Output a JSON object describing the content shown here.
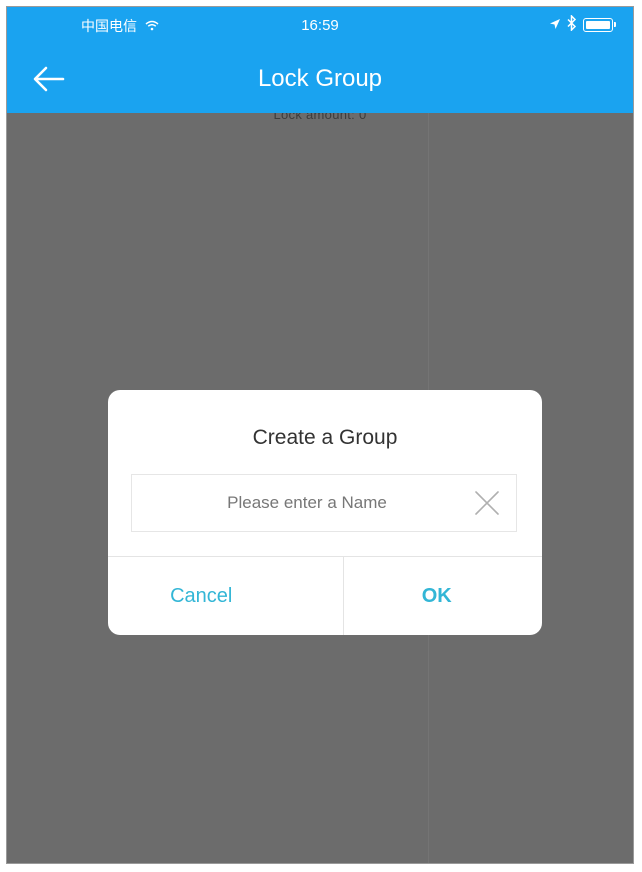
{
  "status_bar": {
    "carrier": "中国电信",
    "wifi_icon": "wifi-icon",
    "time": "16:59",
    "location_icon": "location-arrow-icon",
    "bluetooth_icon": "bluetooth-icon",
    "battery_icon": "battery-icon",
    "battery_level": 1.0
  },
  "nav": {
    "back_icon": "arrow-left-icon",
    "title": "Lock Group"
  },
  "background": {
    "lock_amount_text": "Lock amount: 0"
  },
  "dialog": {
    "title": "Create a Group",
    "name_input": {
      "value": "",
      "placeholder": "Please enter a Name"
    },
    "clear_icon": "close-icon",
    "cancel_label": "Cancel",
    "ok_label": "OK"
  },
  "colors": {
    "nav_bar": "#1aa3f0",
    "overlay": "#6c6c6c",
    "dialog_action": "#33b6d6"
  }
}
